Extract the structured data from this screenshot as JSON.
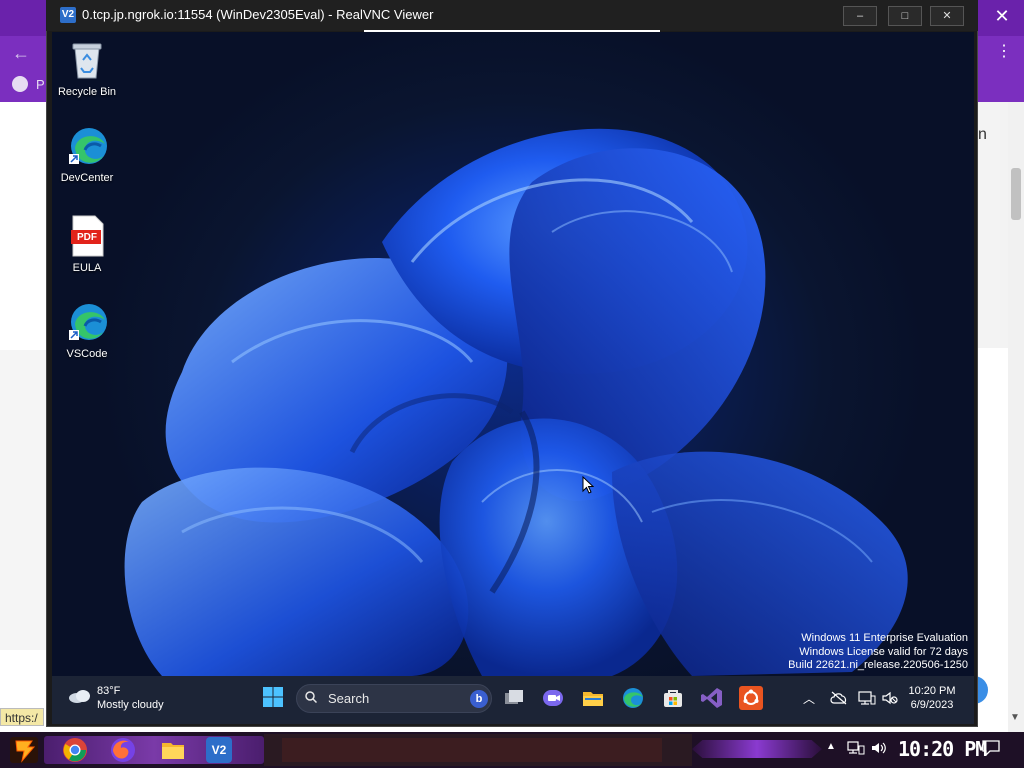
{
  "host_browser": {
    "status_text": "https:/",
    "right_partial_text": "n"
  },
  "vnc_window": {
    "title": "0.tcp.jp.ngrok.io:11554 (WinDev2305Eval) - RealVNC Viewer",
    "icon_text": "V2",
    "min_glyph": "–",
    "max_glyph": "□",
    "close_glyph": "✕"
  },
  "desktop": {
    "icons": [
      {
        "label": "Recycle Bin",
        "icon": "recycle-bin-icon"
      },
      {
        "label": "DevCenter",
        "icon": "edge-shortcut-icon"
      },
      {
        "label": "EULA",
        "icon": "pdf-icon",
        "badge": "PDF"
      },
      {
        "label": "VSCode",
        "icon": "edge-shortcut-icon"
      }
    ],
    "watermark": {
      "line1": "Windows 11 Enterprise Evaluation",
      "line2": "Windows License valid for 72 days",
      "line3": "Build 22621.ni_release.220506-1250"
    }
  },
  "taskbar": {
    "weather_temp": "83°F",
    "weather_desc": "Mostly cloudy",
    "search_label": "Search",
    "bing_label": "b",
    "apps": [
      "task-view",
      "teams",
      "file-explorer",
      "edge",
      "microsoft-store",
      "visual-studio",
      "ubuntu"
    ],
    "time": "10:20 PM",
    "date": "6/9/2023"
  },
  "host_taskbar": {
    "clock": "10:20 PM",
    "vnc_label": "V2",
    "apps": [
      "chrome",
      "firefox",
      "file-explorer",
      "realvnc-viewer"
    ]
  },
  "colors": {
    "host_accent": "#7b2fbf",
    "wallpaper_bloom": "#1f5cf0",
    "taskbar": "#1c2436"
  }
}
